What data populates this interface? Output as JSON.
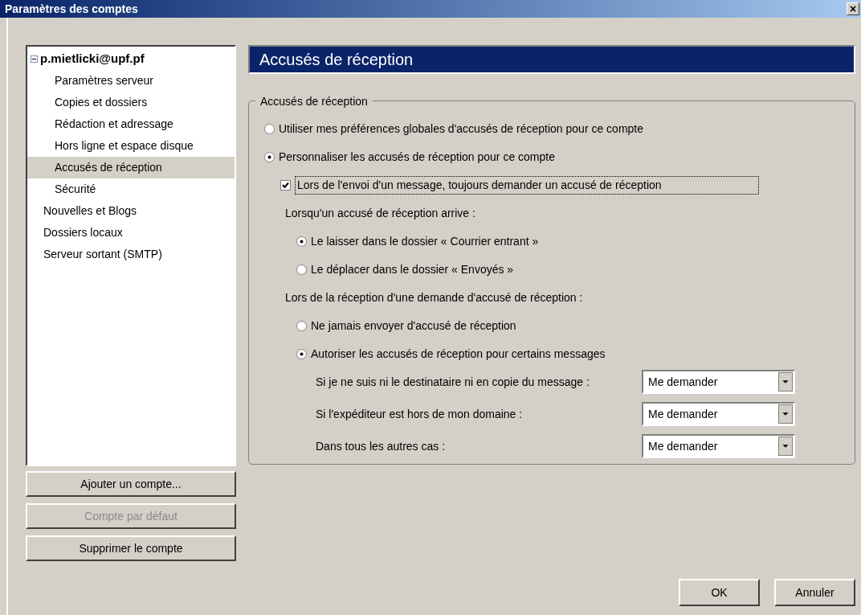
{
  "window": {
    "title": "Paramètres des comptes",
    "close": "×"
  },
  "sidebar": {
    "tree": [
      {
        "label": "p.mietlicki@upf.pf",
        "expanded": true,
        "selected": false,
        "children": [
          {
            "label": "Paramètres serveur",
            "selected": false
          },
          {
            "label": "Copies et dossiers",
            "selected": false
          },
          {
            "label": "Rédaction et adressage",
            "selected": false
          },
          {
            "label": "Hors ligne et espace disque",
            "selected": false
          },
          {
            "label": "Accusés de réception",
            "selected": true
          },
          {
            "label": "Sécurité",
            "selected": false
          }
        ]
      },
      {
        "label": "Nouvelles et Blogs",
        "selected": false
      },
      {
        "label": "Dossiers locaux",
        "selected": false
      },
      {
        "label": "Serveur sortant (SMTP)",
        "selected": false
      }
    ],
    "buttons": [
      {
        "label": "Ajouter un compte...",
        "disabled": false
      },
      {
        "label": "Compte par défaut",
        "disabled": true
      },
      {
        "label": "Supprimer le compte",
        "disabled": false
      }
    ]
  },
  "panel": {
    "title": "Accusés de réception",
    "group": {
      "legend": "Accusés de réception",
      "rows": [
        {
          "kind": "radio",
          "label": "Utiliser mes préférences globales d'accusés de réception pour ce compte",
          "selected": false
        },
        {
          "kind": "radio",
          "label": "Personnaliser les accusés de réception pour ce compte",
          "selected": true,
          "children": [
            {
              "kind": "checkbox",
              "label": "Lors de l'envoi d'un message, toujours demander un accusé de réception",
              "checked": true,
              "focused": true
            },
            {
              "kind": "heading",
              "label": "Lorsqu'un accusé de réception arrive :",
              "children": [
                {
                  "kind": "radio",
                  "label": "Le laisser dans le dossier « Courrier entrant »",
                  "selected": true
                },
                {
                  "kind": "radio",
                  "label": "Le déplacer dans le dossier « Envoyés »",
                  "selected": false
                }
              ]
            },
            {
              "kind": "heading",
              "label": "Lors de la réception d'une demande d'accusé de réception :",
              "children": [
                {
                  "kind": "radio",
                  "label": "Ne jamais envoyer d'accusé de réception",
                  "selected": false
                },
                {
                  "kind": "radio",
                  "label": "Autoriser les accusés de réception pour certains messages",
                  "selected": true,
                  "children": [
                    {
                      "kind": "select",
                      "label": "Si je ne suis ni le destinataire ni en copie du message :",
                      "value": "Me demander"
                    },
                    {
                      "kind": "select",
                      "label": "Si l'expéditeur est hors de mon domaine :",
                      "value": "Me demander"
                    },
                    {
                      "kind": "select",
                      "label": "Dans tous les autres cas :",
                      "value": "Me demander"
                    }
                  ]
                }
              ]
            }
          ]
        }
      ]
    }
  },
  "footer": {
    "buttons": [
      "OK",
      "Annuler"
    ]
  }
}
